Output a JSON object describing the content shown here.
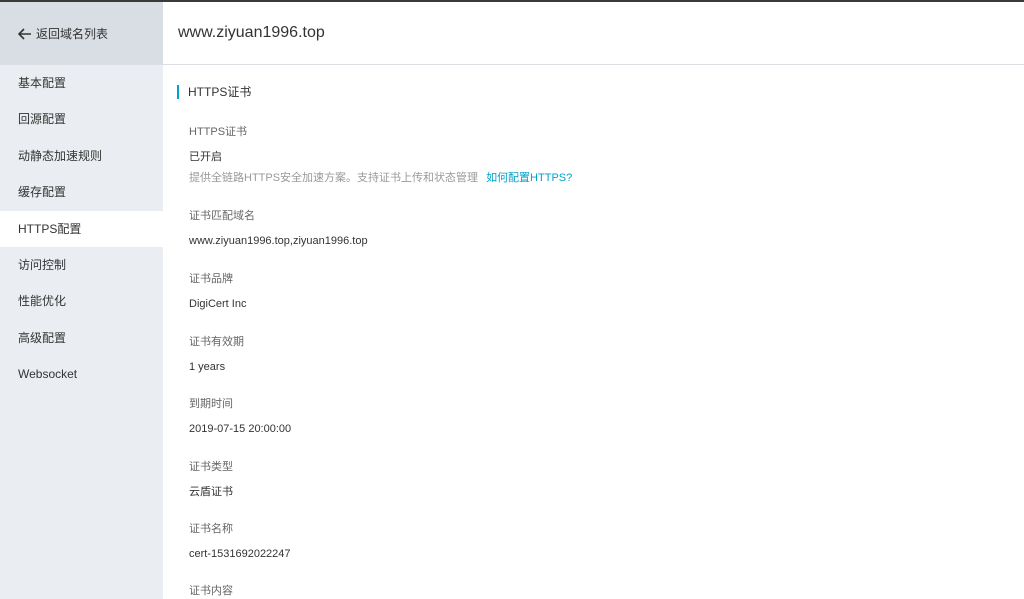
{
  "sidebar": {
    "back_label": "返回域名列表",
    "items": [
      {
        "label": "基本配置"
      },
      {
        "label": "回源配置"
      },
      {
        "label": "动静态加速规则"
      },
      {
        "label": "缓存配置"
      },
      {
        "label": "HTTPS配置"
      },
      {
        "label": "访问控制"
      },
      {
        "label": "性能优化"
      },
      {
        "label": "高级配置"
      },
      {
        "label": "Websocket"
      }
    ],
    "active_index": 4
  },
  "header": {
    "title": "www.ziyuan1996.top"
  },
  "section": {
    "title": "HTTPS证书"
  },
  "fields": {
    "https": {
      "label": "HTTPS证书",
      "value": "已开启",
      "hint": "提供全链路HTTPS安全加速方案。支持证书上传和状态管理",
      "link": "如何配置HTTPS?"
    },
    "domain": {
      "label": "证书匹配域名",
      "value": "www.ziyuan1996.top,ziyuan1996.top"
    },
    "brand": {
      "label": "证书品牌",
      "value": "DigiCert Inc"
    },
    "validity": {
      "label": "证书有效期",
      "value": "1 years"
    },
    "expiry": {
      "label": "到期时间",
      "value": "2019-07-15 20:00:00"
    },
    "type": {
      "label": "证书类型",
      "value": "云盾证书"
    },
    "name": {
      "label": "证书名称",
      "value": "cert-1531692022247"
    },
    "content": {
      "label": "证书内容"
    }
  },
  "colors": {
    "accent": "#00a2ca",
    "sidebar_bg": "#eaedf1",
    "back_bg": "#d9dee4"
  }
}
